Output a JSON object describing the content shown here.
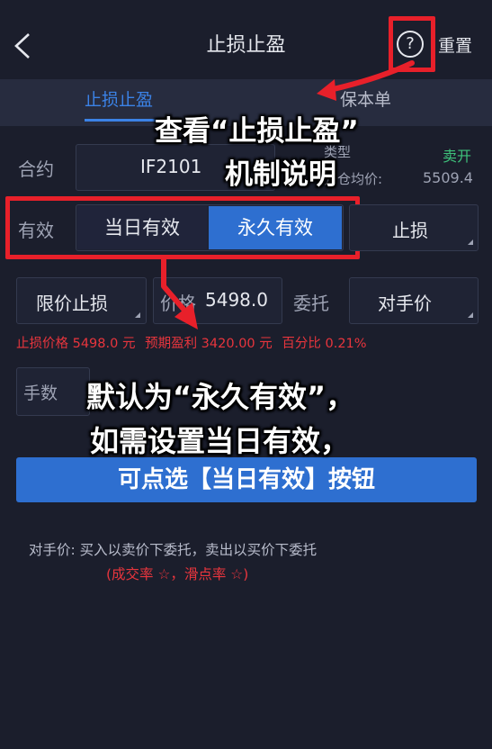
{
  "header": {
    "title": "止损止盈",
    "reset_label": "重置",
    "help_glyph": "?"
  },
  "tabs": [
    {
      "label": "止损止盈",
      "active": true
    },
    {
      "label": "保本单",
      "active": false
    }
  ],
  "form": {
    "contract_label": "合约",
    "contract_value": "IF2101",
    "type_label": "类型",
    "type_value": "卖开",
    "open_avg_label": "开仓均价:",
    "open_avg_value": "5509.4",
    "validity_label": "有效",
    "validity_options": [
      "当日有效",
      "永久有效"
    ],
    "validity_selected": "永久有效",
    "stop_type": "止损",
    "order_type": "限价止损",
    "price_label": "价格",
    "price_value": "5498.0",
    "entrust_label": "委托",
    "entrust_value": "对手价",
    "qty_label": "手数"
  },
  "info": {
    "stop_price": "止损价格 5498.0 元",
    "expected_profit": "预期盈利 3420.00 元",
    "percent": "百分比 0.21%"
  },
  "submit_label": "可点选【当日有效】按钮",
  "notes": {
    "line1": "对手价:  买入以卖价下委托，卖出以买价下委托",
    "line2": "(成交率 ☆，滑点率 ☆)"
  },
  "overlay": {
    "line1": "查看“止损止盈”",
    "line2": "机制说明",
    "line3": "默认为“永久有效”，",
    "line4": "如需设置当日有效，"
  },
  "colors": {
    "accent": "#2e6fd0",
    "annotation": "#e8202a",
    "profit_green": "#3ec27b",
    "loss_red": "#e8353d"
  }
}
